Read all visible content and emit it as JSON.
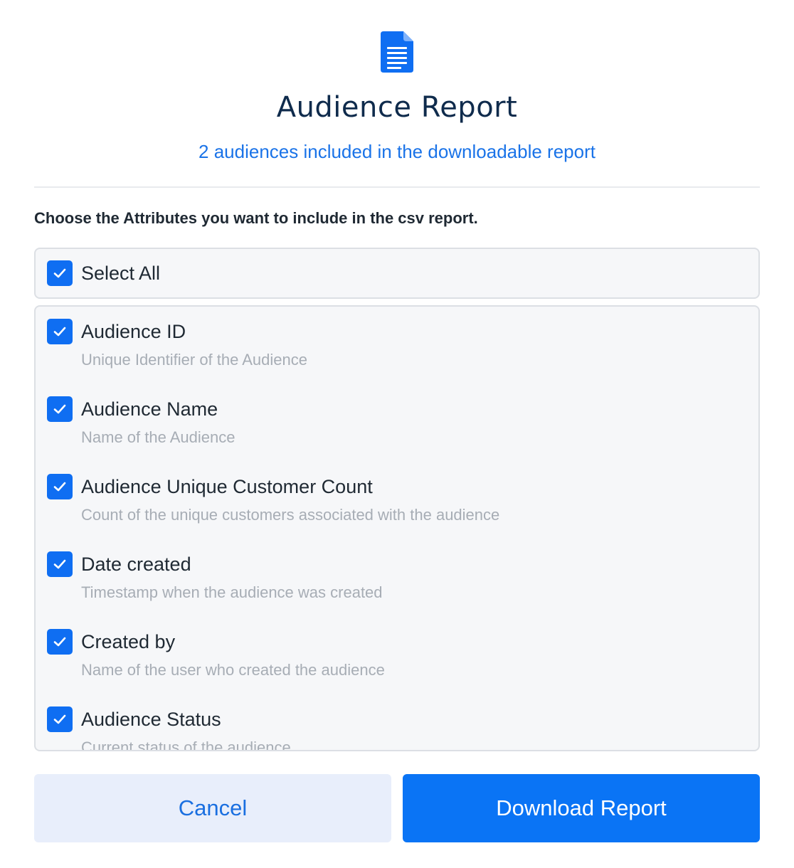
{
  "header": {
    "icon": "document-icon",
    "title": "Audience Report",
    "subtitle": "2 audiences included in the downloadable report"
  },
  "instruction": "Choose the Attributes you want to include in the csv report.",
  "select_all": {
    "label": "Select All",
    "checked": true
  },
  "attributes": [
    {
      "label": "Audience ID",
      "description": "Unique Identifier of the Audience",
      "checked": true
    },
    {
      "label": "Audience Name",
      "description": "Name of the Audience",
      "checked": true
    },
    {
      "label": "Audience Unique Customer Count",
      "description": "Count of the unique customers associated with the audience",
      "checked": true
    },
    {
      "label": "Date created",
      "description": "Timestamp when the audience was created",
      "checked": true
    },
    {
      "label": "Created by",
      "description": "Name of the user who created the audience",
      "checked": true
    },
    {
      "label": "Audience Status",
      "description": "Current status of the audience",
      "checked": true
    }
  ],
  "buttons": {
    "cancel": "Cancel",
    "download": "Download Report"
  },
  "colors": {
    "accent": "#0a74f5",
    "title": "#0f2b4c",
    "subtitle": "#1a73e8",
    "cancel_bg": "#e8eefb"
  }
}
